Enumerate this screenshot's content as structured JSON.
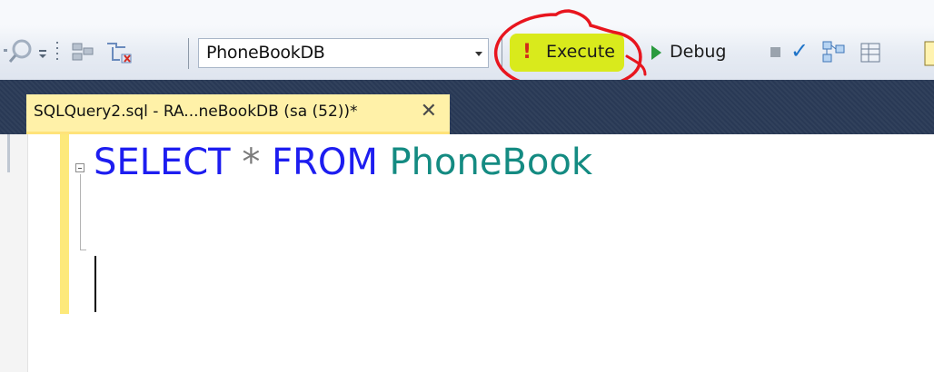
{
  "toolbar": {
    "database_select": {
      "value": "PhoneBookDB"
    },
    "execute_label": "Execute",
    "debug_label": "Debug"
  },
  "document_tab": {
    "title": "SQLQuery2.sql - RA...neBookDB (sa (52))*",
    "close_glyph": "✕"
  },
  "editor": {
    "keyword_select": "SELECT",
    "star": "*",
    "keyword_from": "FROM",
    "table_name": "PhoneBook"
  },
  "colors": {
    "keyword": "#1d1df0",
    "identifier": "#148b82",
    "execute_highlight": "#d9ea1c",
    "annotation_circle": "#e8151e",
    "tab_background": "#fff1a8",
    "dark_band": "#293955"
  },
  "icons": [
    "search-icon",
    "overflow-dropdown-icon",
    "grip-icon",
    "layout-icon",
    "display-estimated-plan-icon",
    "execute-icon",
    "debug-play-icon",
    "stop-icon",
    "parse-check-icon",
    "include-plan-icon",
    "results-grid-icon",
    "results-icon",
    "close-icon",
    "fold-collapse-icon"
  ]
}
